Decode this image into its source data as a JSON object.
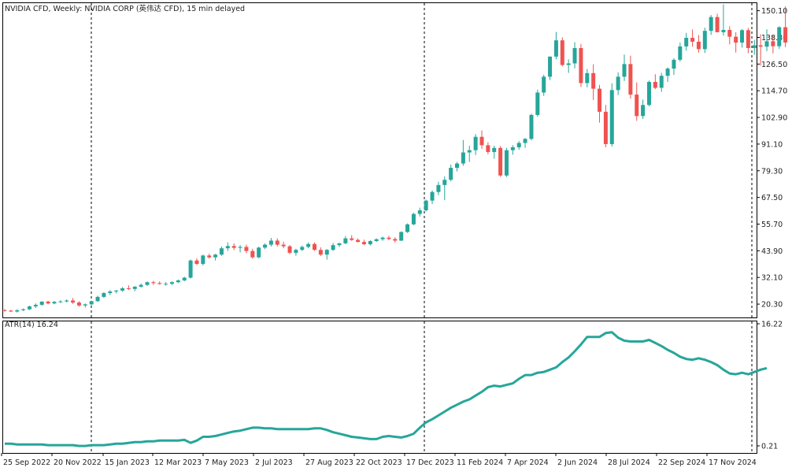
{
  "header": {
    "title": "NVIDIA CFD, Weekly:  NVIDIA CORP (英伟达 CFD), 15 min delayed",
    "indicator": "ATR(14) 16.24"
  },
  "colors": {
    "bull": "#26a69a",
    "bear": "#ef5350",
    "atr_line": "#26a69a",
    "frame": "#000000",
    "background": "#ffffff"
  },
  "chart_data": [
    {
      "type": "candlestick",
      "title": "NVIDIA CFD, Weekly",
      "ylim": [
        14.4,
        153.8
      ],
      "ytick_labels": [
        "150.10",
        "138.30",
        "126.50",
        "114.70",
        "102.90",
        "91.10",
        "79.30",
        "67.50",
        "55.70",
        "43.90",
        "32.10",
        "20.30"
      ],
      "xtick_labels": [
        "25 Sep 2022",
        "20 Nov 2022",
        "15 Jan 2023",
        "12 Mar 2023",
        "7 May 2023",
        "2 Jul 2023",
        "27 Aug 2023",
        "22 Oct 2023",
        "17 Dec 2023",
        "11 Feb 2024",
        "7 Apr 2024",
        "2 Jun 2024",
        "28 Jul 2024",
        "22 Sep 2024",
        "17 Nov 2024"
      ],
      "candles_ohlc": [
        [
          17.6,
          18.2,
          17.0,
          17.4
        ],
        [
          17.4,
          17.8,
          16.8,
          17.0
        ],
        [
          17.0,
          18.0,
          16.6,
          17.6
        ],
        [
          17.6,
          18.4,
          17.2,
          18.0
        ],
        [
          18.0,
          19.6,
          17.7,
          19.3
        ],
        [
          19.3,
          20.6,
          18.6,
          20.0
        ],
        [
          20.0,
          21.6,
          19.5,
          21.4
        ],
        [
          21.4,
          21.8,
          20.2,
          20.6
        ],
        [
          20.6,
          21.7,
          20.2,
          21.3
        ],
        [
          21.3,
          22.0,
          20.8,
          21.5
        ],
        [
          21.5,
          22.4,
          21.0,
          21.9
        ],
        [
          21.9,
          23.0,
          20.4,
          21.0
        ],
        [
          21.0,
          21.6,
          19.2,
          19.7
        ],
        [
          19.7,
          20.6,
          18.8,
          20.2
        ],
        [
          20.2,
          21.8,
          19.8,
          21.6
        ],
        [
          21.6,
          24.0,
          21.3,
          23.5
        ],
        [
          23.5,
          25.6,
          23.0,
          25.2
        ],
        [
          25.2,
          26.5,
          24.3,
          25.9
        ],
        [
          25.9,
          26.5,
          25.0,
          26.3
        ],
        [
          26.3,
          27.8,
          25.8,
          27.3
        ],
        [
          27.3,
          28.6,
          26.6,
          27.0
        ],
        [
          27.0,
          28.3,
          26.0,
          28.0
        ],
        [
          28.0,
          29.4,
          27.6,
          28.8
        ],
        [
          28.8,
          30.3,
          28.4,
          30.0
        ],
        [
          30.0,
          30.6,
          28.8,
          29.6
        ],
        [
          29.6,
          30.4,
          28.9,
          29.2
        ],
        [
          29.2,
          30.1,
          28.5,
          29.3
        ],
        [
          29.3,
          30.4,
          28.7,
          30.0
        ],
        [
          30.0,
          31.2,
          29.6,
          30.8
        ],
        [
          30.8,
          32.4,
          30.4,
          32.0
        ],
        [
          32.0,
          40.0,
          31.6,
          39.6
        ],
        [
          39.6,
          40.6,
          37.6,
          38.1
        ],
        [
          38.1,
          42.2,
          37.4,
          41.8
        ],
        [
          41.8,
          42.6,
          40.4,
          41.0
        ],
        [
          41.0,
          42.5,
          39.6,
          42.2
        ],
        [
          42.2,
          45.8,
          41.7,
          45.0
        ],
        [
          45.0,
          47.6,
          43.8,
          46.0
        ],
        [
          46.0,
          47.2,
          44.2,
          45.2
        ],
        [
          45.2,
          46.4,
          43.2,
          45.6
        ],
        [
          45.6,
          46.6,
          42.8,
          43.8
        ],
        [
          43.8,
          44.8,
          40.4,
          41.0
        ],
        [
          41.0,
          45.7,
          40.6,
          45.3
        ],
        [
          45.3,
          47.2,
          44.6,
          46.6
        ],
        [
          46.6,
          49.6,
          45.8,
          48.4
        ],
        [
          48.4,
          49.4,
          45.8,
          46.6
        ],
        [
          46.6,
          47.9,
          45.0,
          45.9
        ],
        [
          45.9,
          46.4,
          42.4,
          43.0
        ],
        [
          43.0,
          44.8,
          41.7,
          44.3
        ],
        [
          44.3,
          46.2,
          43.8,
          45.6
        ],
        [
          45.6,
          47.6,
          45.0,
          46.9
        ],
        [
          46.9,
          47.6,
          43.8,
          44.3
        ],
        [
          44.3,
          45.4,
          41.6,
          42.2
        ],
        [
          42.2,
          44.7,
          40.0,
          44.3
        ],
        [
          44.3,
          47.3,
          43.8,
          46.4
        ],
        [
          46.4,
          47.4,
          45.6,
          47.2
        ],
        [
          47.2,
          50.4,
          46.8,
          49.4
        ],
        [
          49.4,
          50.8,
          48.3,
          48.7
        ],
        [
          48.7,
          49.4,
          47.6,
          47.8
        ],
        [
          47.8,
          48.8,
          46.4,
          46.8
        ],
        [
          46.8,
          48.6,
          46.2,
          48.2
        ],
        [
          48.2,
          49.4,
          47.8,
          49.0
        ],
        [
          49.0,
          50.2,
          48.3,
          49.7
        ],
        [
          49.7,
          50.5,
          48.6,
          49.1
        ],
        [
          49.1,
          49.9,
          47.6,
          48.4
        ],
        [
          48.4,
          52.5,
          48.2,
          52.2
        ],
        [
          52.2,
          56.0,
          51.8,
          55.6
        ],
        [
          55.6,
          60.7,
          55.2,
          60.2
        ],
        [
          60.2,
          63.0,
          59.0,
          61.8
        ],
        [
          61.8,
          66.5,
          61.3,
          66.1
        ],
        [
          66.1,
          70.6,
          64.6,
          69.9
        ],
        [
          69.9,
          74.4,
          68.5,
          73.0
        ],
        [
          73.0,
          76.8,
          66.3,
          75.3
        ],
        [
          75.3,
          82.0,
          74.6,
          80.6
        ],
        [
          80.6,
          83.2,
          79.0,
          82.5
        ],
        [
          82.5,
          92.9,
          81.5,
          87.4
        ],
        [
          87.4,
          90.4,
          83.2,
          88.4
        ],
        [
          88.4,
          95.5,
          86.2,
          94.3
        ],
        [
          94.3,
          97.2,
          89.0,
          90.6
        ],
        [
          90.6,
          91.9,
          86.6,
          87.6
        ],
        [
          87.6,
          90.4,
          84.6,
          89.4
        ],
        [
          89.4,
          90.2,
          76.6,
          77.2
        ],
        [
          77.2,
          89.4,
          76.6,
          88.4
        ],
        [
          88.4,
          90.6,
          86.4,
          89.7
        ],
        [
          89.7,
          92.4,
          88.6,
          91.6
        ],
        [
          91.6,
          93.8,
          89.4,
          93.4
        ],
        [
          93.4,
          104.5,
          92.8,
          104.0
        ],
        [
          104.0,
          115.2,
          103.2,
          113.9
        ],
        [
          113.9,
          121.8,
          112.4,
          120.9
        ],
        [
          120.9,
          129.9,
          119.4,
          129.8
        ],
        [
          129.8,
          140.7,
          128.6,
          137.0
        ],
        [
          137.0,
          138.3,
          125.5,
          126.1
        ],
        [
          126.1,
          128.6,
          122.6,
          126.8
        ],
        [
          126.8,
          136.2,
          124.6,
          133.6
        ],
        [
          133.6,
          135.4,
          116.4,
          118.1
        ],
        [
          118.1,
          124.3,
          116.2,
          122.5
        ],
        [
          122.5,
          126.4,
          110.6,
          115.6
        ],
        [
          115.6,
          117.3,
          100.6,
          105.4
        ],
        [
          105.4,
          108.4,
          89.7,
          91.1
        ],
        [
          91.1,
          118.0,
          90.0,
          115.0
        ],
        [
          115.0,
          122.8,
          112.8,
          120.9
        ],
        [
          120.9,
          130.7,
          119.0,
          126.5
        ],
        [
          126.5,
          130.2,
          111.2,
          113.0
        ],
        [
          113.0,
          118.4,
          101.4,
          103.5
        ],
        [
          103.5,
          110.8,
          102.2,
          108.4
        ],
        [
          108.4,
          119.2,
          107.8,
          118.6
        ],
        [
          118.6,
          122.0,
          115.4,
          116.0
        ],
        [
          116.0,
          122.6,
          114.2,
          121.3
        ],
        [
          121.3,
          125.0,
          118.6,
          124.5
        ],
        [
          124.5,
          129.1,
          121.7,
          128.4
        ],
        [
          128.4,
          136.0,
          127.6,
          134.3
        ],
        [
          134.3,
          140.3,
          132.4,
          138.1
        ],
        [
          138.1,
          141.8,
          134.2,
          136.4
        ],
        [
          136.4,
          139.3,
          131.6,
          133.1
        ],
        [
          133.1,
          142.6,
          131.4,
          141.2
        ],
        [
          141.2,
          148.2,
          139.4,
          147.3
        ],
        [
          147.3,
          148.8,
          140.5,
          140.6
        ],
        [
          140.6,
          152.9,
          139.1,
          141.6
        ],
        [
          141.6,
          143.2,
          135.2,
          138.6
        ],
        [
          138.6,
          140.6,
          131.6,
          136.0
        ],
        [
          136.0,
          142.0,
          133.8,
          141.5
        ],
        [
          141.5,
          142.5,
          131.3,
          133.6
        ],
        [
          133.6,
          137.2,
          130.6,
          134.8
        ],
        [
          134.8,
          139.7,
          125.8,
          134.2
        ],
        [
          134.2,
          141.9,
          132.2,
          136.6
        ],
        [
          136.6,
          139.5,
          131.2,
          134.4
        ],
        [
          134.4,
          143.2,
          133.2,
          142.8
        ],
        [
          142.8,
          152.0,
          134.0,
          136.0
        ]
      ]
    },
    {
      "type": "line",
      "series": [
        {
          "name": "ATR(14)",
          "values": [
            0.5,
            0.5,
            0.4,
            0.4,
            0.4,
            0.4,
            0.4,
            0.3,
            0.3,
            0.3,
            0.3,
            0.3,
            0.2,
            0.2,
            0.3,
            0.3,
            0.3,
            0.4,
            0.5,
            0.5,
            0.6,
            0.7,
            0.7,
            0.8,
            0.8,
            0.9,
            0.9,
            0.9,
            0.9,
            1.0,
            0.6,
            0.9,
            1.4,
            1.4,
            1.5,
            1.7,
            1.9,
            2.1,
            2.2,
            2.4,
            2.6,
            2.6,
            2.5,
            2.5,
            2.4,
            2.4,
            2.4,
            2.4,
            2.4,
            2.4,
            2.5,
            2.5,
            2.3,
            2.0,
            1.8,
            1.6,
            1.4,
            1.3,
            1.2,
            1.1,
            1.1,
            1.4,
            1.5,
            1.4,
            1.3,
            1.5,
            1.8,
            2.6,
            3.3,
            3.7,
            4.2,
            4.7,
            5.2,
            5.6,
            6.0,
            6.3,
            6.8,
            7.3,
            7.9,
            8.1,
            8.0,
            8.2,
            8.4,
            9.0,
            9.5,
            9.5,
            9.8,
            9.9,
            10.2,
            10.5,
            11.2,
            11.8,
            12.6,
            13.5,
            14.5,
            14.5,
            14.5,
            15.0,
            15.1,
            14.4,
            14.0,
            13.9,
            13.9,
            13.9,
            14.1,
            13.7,
            13.3,
            12.8,
            12.4,
            11.9,
            11.6,
            11.5,
            11.7,
            11.5,
            11.2,
            10.8,
            10.2,
            9.7,
            9.6,
            9.8,
            9.6,
            9.9,
            10.2,
            10.4
          ],
          "ylim": [
            0.21,
            16.22
          ],
          "ytick_labels": [
            "16.22",
            "0.21"
          ]
        }
      ]
    }
  ]
}
